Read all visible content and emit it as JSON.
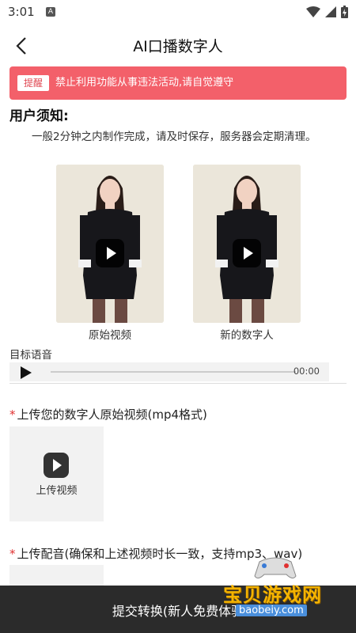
{
  "status_bar": {
    "time": "3:01",
    "app_icon_letter": "A"
  },
  "header": {
    "title": "AI口播数字人"
  },
  "warning": {
    "tag": "提醒",
    "message": "禁止利用功能从事违法活动,请自觉遵守"
  },
  "notice": {
    "title": "用户须知:",
    "body": "一般2分钟之内制作完成，请及时保存，服务器会定期清理。"
  },
  "videos": [
    {
      "label": "原始视频"
    },
    {
      "label": "新的数字人"
    }
  ],
  "audio": {
    "label": "目标语音",
    "time": "00:00"
  },
  "upload_video": {
    "required_mark": "*",
    "label": "上传您的数字人原始视频(mp4格式)",
    "button_text": "上传视频"
  },
  "upload_audio": {
    "required_mark": "*",
    "label": "上传配音(确保和上述视频时长一致，支持mp3、wav)"
  },
  "submit": {
    "label": "提交转换(新人免费体验"
  },
  "watermark": {
    "name": "宝贝游戏网",
    "url": "baobeiy.com"
  },
  "colors": {
    "warning_bg": "#f3606a",
    "submit_bg": "#2b2b2b",
    "required": "#e03030"
  }
}
